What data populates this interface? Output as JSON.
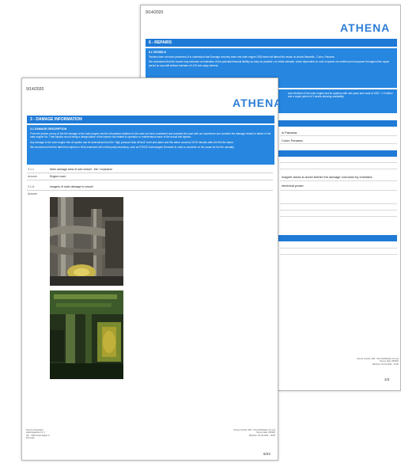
{
  "back_page": {
    "date": "9/14/2020",
    "logo": "ATHENA",
    "section_title": "6 - REPAIRS",
    "box_heading": "6.1 VESSELS",
    "box_para1": "Tenders have not been presented; it is understood that Damage recovery team and main engine OEM team will attend the vessel on arrival Marseille - Colon, Panama.",
    "box_para2": "We understand that the insurer may welcome an indication of the potential financial liability as early as possible; our initial estimate, which dependent on cost of spares not verified and manpower throughout the repair period on any shift without estimate of LOH and cargo interest.",
    "box_para3": "and refurbish of the main engine and its systems with new parts and costs of USD ~1.3 million and a repair period of 3 weeks allowing availability",
    "snippet1": "in Panama.",
    "snippet2": "Colon Panama.",
    "snippet3": "magnet areas to avoid further the damage corrosion by chlorides.",
    "snippet4": "electrical power.",
    "footer_line1": "Survey Invoice: 990 - First Notification of Loss",
    "footer_line2": "Survey date: 05/9/20",
    "footer_line3": "Revision: 02.04.2020 - 10:00",
    "page_number": "2/3"
  },
  "front_page": {
    "date": "9/14/2020",
    "logo": "ATHENA",
    "section_title": "3 - DAMAGE INFORMATION",
    "box_heading": "3.1 DAMAGE DESCRIPTION",
    "box_para1": "From the picture survey of the fire damage to the main engine and the information obtained in the case we have considered and revealed the case with our experience and consider the damage related to failure of the main engine No 7 fuel injector as not being a design failure of the injector but related to operation or maintenance issue of the actual fuel injector.",
    "box_para2": "Any damage to the main engine fuel oil system can be determined from the \"high pressure leak off tank\" level and alarm and this alarm occurred 02:25 minutes after the first fire alarm.",
    "box_para3": "We recommend that the failed fuel injector is NOA examined with a third-party laboratory, such as FORCE technologies Denmark in order to conclude on the cause for the fire casualty.",
    "rows": [
      {
        "num": "3.1.1",
        "text": "Main damage area of own vessel - fire / explosion"
      },
      {
        "num": "Answer",
        "text": "Engine room"
      },
      {
        "num": "3.1.8",
        "text": "Image/s of main damage to vessel"
      },
      {
        "num": "Answer",
        "text": ""
      }
    ],
    "footer_left1": "Survey Association",
    "footer_left2": "Hafensgaarden Nr. 1",
    "footer_left3": "DK - 7300 Copenhagen K",
    "footer_left4": "Denmark",
    "footer_right1": "Survey Invoice: 990 - First Notification of Loss",
    "footer_right2": "Survey date: 05/9/20",
    "footer_right3": "Revision: 02.04.2020 - 10:00",
    "page_number": "8/23"
  }
}
